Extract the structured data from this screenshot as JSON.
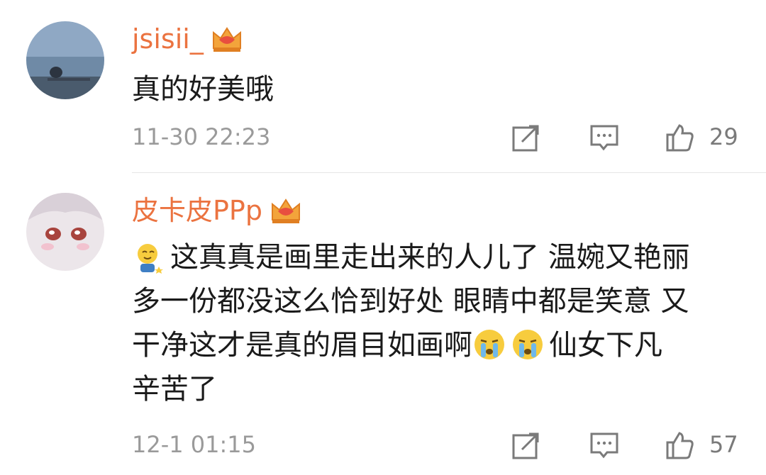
{
  "comments": [
    {
      "username": "jsisii_",
      "text_lines": [
        "真的好美哦"
      ],
      "timestamp": "11-30 22:23",
      "likes": "29",
      "badge_icon": "crown-vip-icon"
    },
    {
      "username": "皮卡皮PPp",
      "text_lines": [
        "这真真是画里走出来的人儿了 温婉又艳丽",
        "多一份都没这么恰到好处 眼睛中都是笑意 又",
        "干净这才是真的眉目如画啊",
        "仙女下凡",
        "辛苦了"
      ],
      "timestamp": "12-1 01:15",
      "likes": "57",
      "badge_icon": "crown-vip-icon",
      "emojis": [
        "blush-emoji",
        "crying-emoji",
        "crying-emoji"
      ]
    }
  ],
  "colors": {
    "username": "#eb7340",
    "meta": "#9a9a9a",
    "text": "#1a1a1a"
  }
}
